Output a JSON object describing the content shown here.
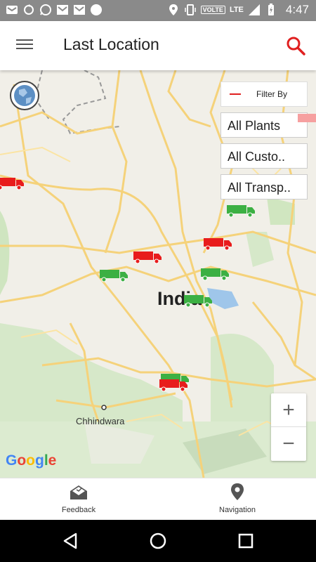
{
  "status_bar": {
    "time": "4:47",
    "volte": "VOLTE",
    "lte": "LTE",
    "icons": [
      "gmail-icon",
      "sync-icon",
      "whatsapp-icon",
      "mail-icon",
      "mail-icon",
      "circle-icon",
      "location-icon",
      "vibrate-icon",
      "wifi-icon",
      "signal-icon",
      "battery-charging-icon"
    ]
  },
  "app_bar": {
    "title": "Last Location",
    "menu_icon": "hamburger-menu-icon",
    "search_icon": "search-icon",
    "accent_color": "#e02020"
  },
  "filter": {
    "header_label": "Filter By",
    "plants": "All Plants",
    "customers": "All Custo..",
    "transporters": "All Transp.."
  },
  "map": {
    "country_label": "India",
    "city_label": "Chhindwara",
    "attribution": "Google",
    "zoom_in": "+",
    "zoom_out": "−",
    "truck_colors": {
      "red": "#e81c1c",
      "green": "#3cb043"
    }
  },
  "bottom_nav": {
    "feedback_label": "Feedback",
    "navigation_label": "Navigation"
  },
  "system_nav": {
    "back": "back-icon",
    "home": "home-icon",
    "recents": "recents-icon"
  }
}
